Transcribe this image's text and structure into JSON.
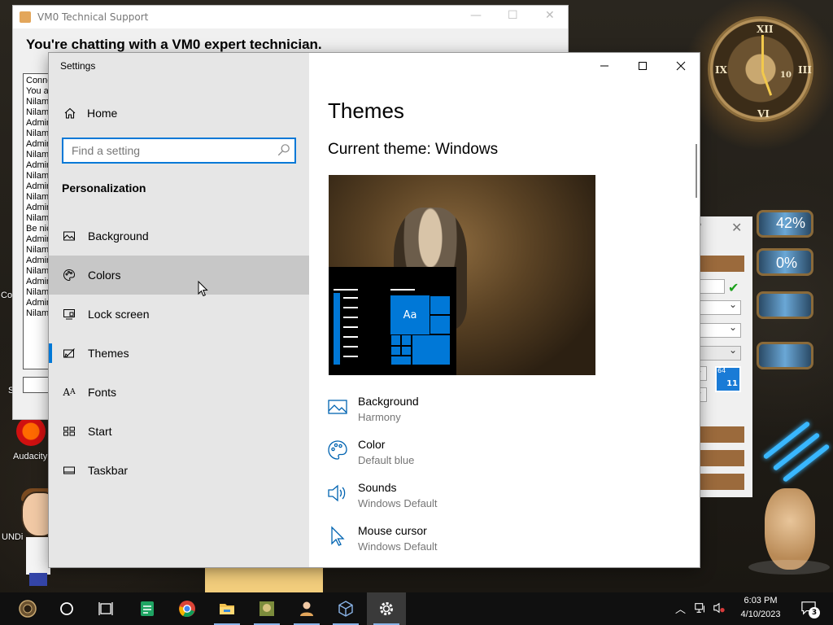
{
  "desktop": {
    "audacity_label": "Audacity",
    "undo_label": "UNDi",
    "co_label": "Co",
    "s_label": "S",
    "gauge1_pct": "42%",
    "gauge2_pct": "0%",
    "clock_numerals": [
      "XII",
      "III",
      "IX",
      "VI",
      "10"
    ],
    "badge64": "64",
    "badge11": "11"
  },
  "chat": {
    "title": "VM0 Technical Support",
    "heading": "You're chatting with a VM0 expert technician.",
    "log": [
      "Conne",
      "You ar",
      "Nilam",
      "Nilam",
      "Admin",
      "Nilam",
      "Admin",
      "Nilam",
      "Admin",
      "Nilam",
      "Admin",
      "Nilam",
      "Admin",
      "Nilam",
      "Be nic",
      "Admin",
      "Nilam",
      "Admin",
      "Nilam",
      "Admin",
      "Nilam",
      "Admin",
      "Nilam"
    ]
  },
  "settings": {
    "window_title": "Settings",
    "home_label": "Home",
    "search_placeholder": "Find a setting",
    "section_label": "Personalization",
    "nav": [
      {
        "label": "Background",
        "icon": "picture-icon"
      },
      {
        "label": "Colors",
        "icon": "palette-icon"
      },
      {
        "label": "Lock screen",
        "icon": "lock-screen-icon"
      },
      {
        "label": "Themes",
        "icon": "themes-icon"
      },
      {
        "label": "Fonts",
        "icon": "fonts-icon"
      },
      {
        "label": "Start",
        "icon": "start-icon"
      },
      {
        "label": "Taskbar",
        "icon": "taskbar-icon"
      }
    ],
    "selected_nav": "Themes",
    "hover_nav": "Colors",
    "page_title": "Themes",
    "current_theme": "Current theme: Windows",
    "preview_tile_text": "Aa",
    "theme_settings": [
      {
        "label": "Background",
        "value": "Harmony",
        "icon": "picture-icon"
      },
      {
        "label": "Color",
        "value": "Default blue",
        "icon": "palette-icon"
      },
      {
        "label": "Sounds",
        "value": "Windows Default",
        "icon": "speaker-icon"
      },
      {
        "label": "Mouse cursor",
        "value": "Windows Default",
        "icon": "cursor-icon"
      }
    ],
    "accent": "#0078d7"
  },
  "taskbar": {
    "time": "6:03 PM",
    "date": "4/10/2023",
    "notification_count": "3",
    "apps": [
      "steampunk-start-icon",
      "cortana-icon",
      "task-view-icon",
      "sheets-icon",
      "chrome-icon",
      "file-explorer-icon",
      "game-icon",
      "support-icon",
      "virtualbox-icon",
      "settings-gear-icon"
    ]
  }
}
